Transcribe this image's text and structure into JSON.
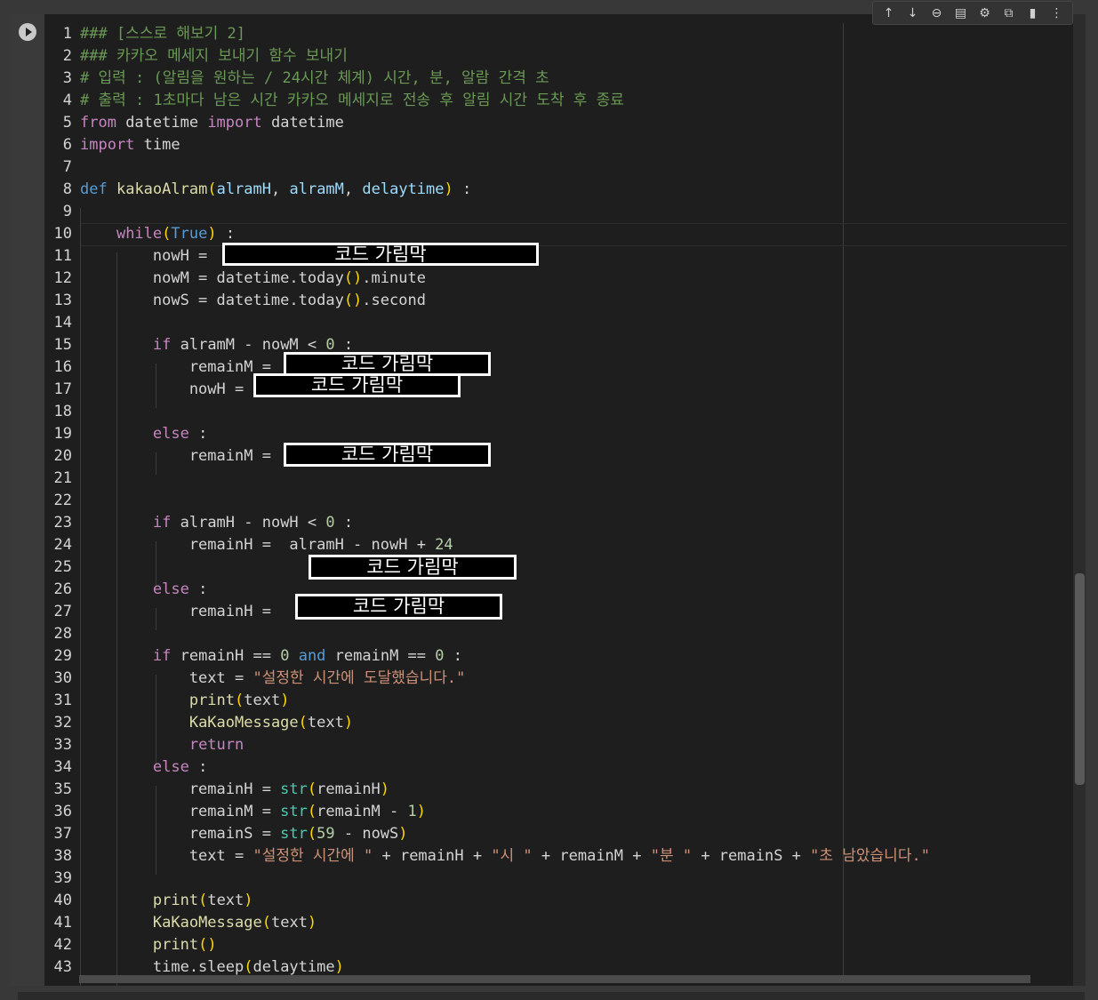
{
  "toolbar": {
    "icons": [
      "arrow-up-icon",
      "arrow-down-icon",
      "link-icon",
      "comment-icon",
      "gear-icon",
      "mirror-cell-icon",
      "trash-icon",
      "more-vert-icon"
    ],
    "glyphs": [
      "↑",
      "↓",
      "⊖",
      "▤",
      "⚙",
      "⧉",
      "▮",
      "⋮"
    ]
  },
  "run_button": {
    "icon": "play-icon"
  },
  "editor": {
    "line_numbers": [
      "1",
      "2",
      "3",
      "4",
      "5",
      "6",
      "7",
      "8",
      "9",
      "10",
      "11",
      "12",
      "13",
      "14",
      "15",
      "16",
      "17",
      "18",
      "19",
      "20",
      "21",
      "22",
      "23",
      "24",
      "25",
      "26",
      "27",
      "28",
      "29",
      "30",
      "31",
      "32",
      "33",
      "34",
      "35",
      "36",
      "37",
      "38",
      "39",
      "40",
      "41",
      "42",
      "43"
    ],
    "lines": [
      [
        [
          "cm",
          "### [스스로 해보기 2]"
        ]
      ],
      [
        [
          "cm",
          "### 카카오 메세지 보내기 함수 보내기"
        ]
      ],
      [
        [
          "cm",
          "# 입력 : (알림을 원하는 / 24시간 체계) 시간, 분, 알람 간격 초"
        ]
      ],
      [
        [
          "cm",
          "# 출력 : 1초마다 남은 시간 카카오 메세지로 전송 후 알림 시간 도착 후 종료"
        ]
      ],
      [
        [
          "kw",
          "from"
        ],
        [
          "tx",
          " datetime "
        ],
        [
          "kw",
          "import"
        ],
        [
          "tx",
          " datetime"
        ]
      ],
      [
        [
          "kw",
          "import"
        ],
        [
          "tx",
          " time"
        ]
      ],
      [],
      [
        [
          "bl",
          "def"
        ],
        [
          "tx",
          " "
        ],
        [
          "fn",
          "kakaoAlram"
        ],
        [
          "br",
          "("
        ],
        [
          "pr",
          "alramH"
        ],
        [
          "tx",
          ", "
        ],
        [
          "pr",
          "alramM"
        ],
        [
          "tx",
          ", "
        ],
        [
          "pr",
          "delaytime"
        ],
        [
          "br",
          ")"
        ],
        [
          "tx",
          " :"
        ]
      ],
      [],
      [
        [
          "tx",
          "    "
        ],
        [
          "kw",
          "while"
        ],
        [
          "br",
          "("
        ],
        [
          "bl",
          "True"
        ],
        [
          "br",
          ")"
        ],
        [
          "tx",
          " :"
        ]
      ],
      [
        [
          "tx",
          "        nowH = "
        ]
      ],
      [
        [
          "tx",
          "        nowM = datetime.today"
        ],
        [
          "br",
          "()"
        ],
        [
          "tx",
          ".minute"
        ]
      ],
      [
        [
          "tx",
          "        nowS = datetime.today"
        ],
        [
          "br",
          "()"
        ],
        [
          "tx",
          ".second"
        ]
      ],
      [],
      [
        [
          "tx",
          "        "
        ],
        [
          "kw",
          "if"
        ],
        [
          "tx",
          " alramM - nowM < "
        ],
        [
          "num",
          "0"
        ],
        [
          "tx",
          " :"
        ]
      ],
      [
        [
          "tx",
          "            remainM = "
        ]
      ],
      [
        [
          "tx",
          "            nowH = "
        ]
      ],
      [],
      [
        [
          "tx",
          "        "
        ],
        [
          "kw",
          "else"
        ],
        [
          "tx",
          " :"
        ]
      ],
      [
        [
          "tx",
          "            remainM = "
        ]
      ],
      [],
      [],
      [
        [
          "tx",
          "        "
        ],
        [
          "kw",
          "if"
        ],
        [
          "tx",
          " alramH - nowH < "
        ],
        [
          "num",
          "0"
        ],
        [
          "tx",
          " :"
        ]
      ],
      [
        [
          "tx",
          "            remainH =  alramH - nowH + "
        ],
        [
          "num",
          "24"
        ]
      ],
      [],
      [
        [
          "tx",
          "        "
        ],
        [
          "kw",
          "else"
        ],
        [
          "tx",
          " :"
        ]
      ],
      [
        [
          "tx",
          "            remainH = "
        ]
      ],
      [],
      [
        [
          "tx",
          "        "
        ],
        [
          "kw",
          "if"
        ],
        [
          "tx",
          " remainH == "
        ],
        [
          "num",
          "0"
        ],
        [
          "tx",
          " "
        ],
        [
          "bl",
          "and"
        ],
        [
          "tx",
          " remainM == "
        ],
        [
          "num",
          "0"
        ],
        [
          "tx",
          " :"
        ]
      ],
      [
        [
          "tx",
          "            text = "
        ],
        [
          "str",
          "\"설정한 시간에 도달했습니다.\""
        ]
      ],
      [
        [
          "tx",
          "            "
        ],
        [
          "fn",
          "print"
        ],
        [
          "br",
          "("
        ],
        [
          "tx",
          "text"
        ],
        [
          "br",
          ")"
        ]
      ],
      [
        [
          "tx",
          "            "
        ],
        [
          "fn",
          "KaKaoMessage"
        ],
        [
          "br",
          "("
        ],
        [
          "tx",
          "text"
        ],
        [
          "br",
          ")"
        ]
      ],
      [
        [
          "tx",
          "            "
        ],
        [
          "kw",
          "return"
        ]
      ],
      [
        [
          "tx",
          "        "
        ],
        [
          "kw",
          "else"
        ],
        [
          "tx",
          " :"
        ]
      ],
      [
        [
          "tx",
          "            remainH = "
        ],
        [
          "bi",
          "str"
        ],
        [
          "br",
          "("
        ],
        [
          "tx",
          "remainH"
        ],
        [
          "br",
          ")"
        ]
      ],
      [
        [
          "tx",
          "            remainM = "
        ],
        [
          "bi",
          "str"
        ],
        [
          "br",
          "("
        ],
        [
          "tx",
          "remainM - "
        ],
        [
          "num",
          "1"
        ],
        [
          "br",
          ")"
        ]
      ],
      [
        [
          "tx",
          "            remainS = "
        ],
        [
          "bi",
          "str"
        ],
        [
          "br",
          "("
        ],
        [
          "num",
          "59"
        ],
        [
          "tx",
          " - nowS"
        ],
        [
          "br",
          ")"
        ]
      ],
      [
        [
          "tx",
          "            text = "
        ],
        [
          "str",
          "\"설정한 시간에 \""
        ],
        [
          "tx",
          " + remainH + "
        ],
        [
          "str",
          "\"시 \""
        ],
        [
          "tx",
          " + remainM + "
        ],
        [
          "str",
          "\"분 \""
        ],
        [
          "tx",
          " + remainS + "
        ],
        [
          "str",
          "\"초 남았습니다.\""
        ]
      ],
      [],
      [
        [
          "tx",
          "        "
        ],
        [
          "fn",
          "print"
        ],
        [
          "br",
          "("
        ],
        [
          "tx",
          "text"
        ],
        [
          "br",
          ")"
        ]
      ],
      [
        [
          "tx",
          "        "
        ],
        [
          "fn",
          "KaKaoMessage"
        ],
        [
          "br",
          "("
        ],
        [
          "tx",
          "text"
        ],
        [
          "br",
          ")"
        ]
      ],
      [
        [
          "tx",
          "        "
        ],
        [
          "fn",
          "print"
        ],
        [
          "br",
          "()"
        ]
      ],
      [
        [
          "tx",
          "        time.sleep"
        ],
        [
          "br",
          "("
        ],
        [
          "tx",
          "delaytime"
        ],
        [
          "br",
          ")"
        ]
      ]
    ]
  },
  "masks": [
    {
      "label": "코드 가림막",
      "line": 11
    },
    {
      "label": "코드 가림막",
      "line": 16
    },
    {
      "label": "코드 가림막",
      "line": 17
    },
    {
      "label": "코드 가림막",
      "line": 20
    },
    {
      "label": "코드 가림막",
      "line": 25
    },
    {
      "label": "코드 가림막",
      "line": 27
    }
  ]
}
